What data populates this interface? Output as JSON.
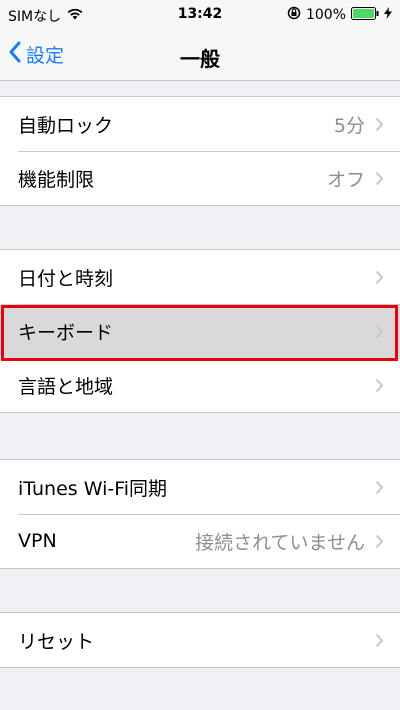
{
  "status": {
    "carrier": "SIMなし",
    "time": "13:42",
    "battery": "100%",
    "wifi_icon": "wifi-icon",
    "lock_icon": "orientation-lock-icon",
    "battery_icon": "battery-icon",
    "charging_icon": "charging-bolt-icon",
    "battery_color": "#4cd964"
  },
  "nav": {
    "back_label": "設定",
    "title": "一般",
    "accent": "#1a7cf7"
  },
  "groups": [
    {
      "rows": [
        {
          "label": "自動ロック",
          "value": "5分"
        },
        {
          "label": "機能制限",
          "value": "オフ"
        }
      ]
    },
    {
      "rows": [
        {
          "label": "日付と時刻",
          "value": ""
        },
        {
          "label": "キーボード",
          "value": "",
          "highlighted": true
        },
        {
          "label": "言語と地域",
          "value": ""
        }
      ]
    },
    {
      "rows": [
        {
          "label": "iTunes Wi-Fi同期",
          "value": ""
        },
        {
          "label": "VPN",
          "value": "接続されていません"
        }
      ]
    },
    {
      "rows": [
        {
          "label": "リセット",
          "value": ""
        }
      ]
    }
  ],
  "highlight_color": "#e60012"
}
